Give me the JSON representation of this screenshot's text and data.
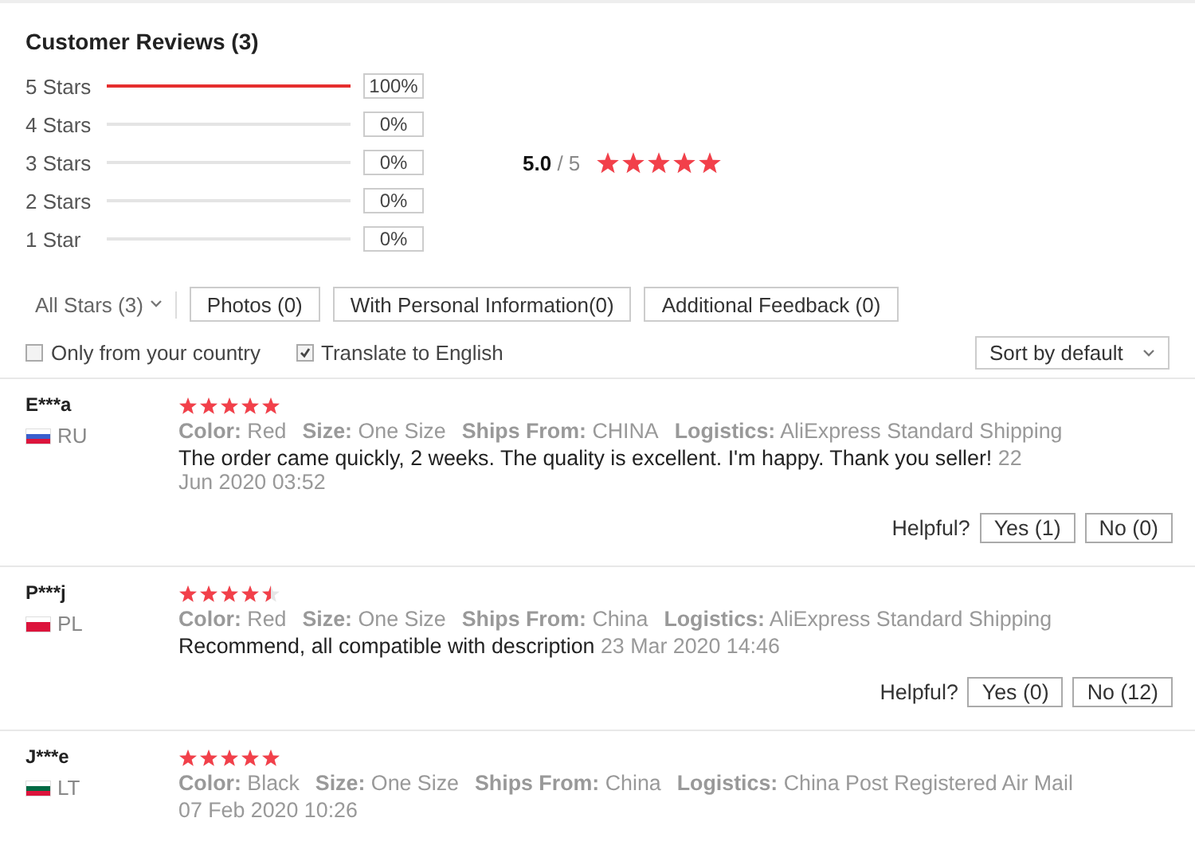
{
  "title": "Customer Reviews (3)",
  "distribution": [
    {
      "label": "5 Stars",
      "level": 1,
      "percent": "100%"
    },
    {
      "label": "4 Stars",
      "level": 0,
      "percent": "0%"
    },
    {
      "label": "3 Stars",
      "level": 0,
      "percent": "0%"
    },
    {
      "label": "2 Stars",
      "level": 0,
      "percent": "0%"
    },
    {
      "label": "1 Star",
      "level": 0,
      "percent": "0%"
    }
  ],
  "score": {
    "value": "5.0",
    "out_of": "/ 5",
    "stars": 5
  },
  "filters": {
    "star_filter": "All Stars (3)",
    "buttons": [
      "Photos (0)",
      "With Personal Information(0)",
      "Additional Feedback (0)"
    ]
  },
  "options": [
    {
      "label": "Only from your country",
      "checked": false
    },
    {
      "label": "Translate to English",
      "checked": true
    }
  ],
  "sort": "Sort by default",
  "reviews": [
    {
      "name": "E***a",
      "color": "#3a5fcd",
      "country": "RU",
      "stars": 5,
      "attributes": [
        {
          "label": "Color:",
          "value": "Red"
        },
        {
          "label": "Size:",
          "value": "One Size"
        },
        {
          "label": "Ships From:",
          "value": "CHINA"
        },
        {
          "label": "Logistics:",
          "value": "AliExpress Standard Shipping"
        }
      ],
      "text": "The order came quickly, 2 weeks. The quality is excellent. I'm happy. Thank you seller!",
      "date": "22 Jun 2020 03:52",
      "helpful": {
        "label": "Helpful?",
        "yes": "Yes (1)",
        "no": "No (0)"
      }
    },
    {
      "name": "P***j",
      "color": "#dc143c",
      "country": "PL",
      "stars": 4.5,
      "attributes": [
        {
          "label": "Color:",
          "value": "Red"
        },
        {
          "label": "Size:",
          "value": "One Size"
        },
        {
          "label": "Ships From:",
          "value": "China"
        },
        {
          "label": "Logistics:",
          "value": "AliExpress Standard Shipping"
        }
      ],
      "text": "Recommend, all compatible with description",
      "date": "23 Mar 2020 14:46",
      "helpful": {
        "label": "Helpful?",
        "yes": "Yes (0)",
        "no": "No (12)"
      }
    },
    {
      "name": "J***e",
      "color": "#006a44",
      "country": "LT",
      "stars": 5,
      "attributes": [
        {
          "label": "Color:",
          "value": "Black"
        },
        {
          "label": "Size:",
          "value": "One Size"
        },
        {
          "label": "Ships From:",
          "value": "China"
        },
        {
          "label": "Logistics:",
          "value": "China Post Registered Air Mail"
        }
      ],
      "date": "07 Feb 2020 10:26"
    }
  ]
}
